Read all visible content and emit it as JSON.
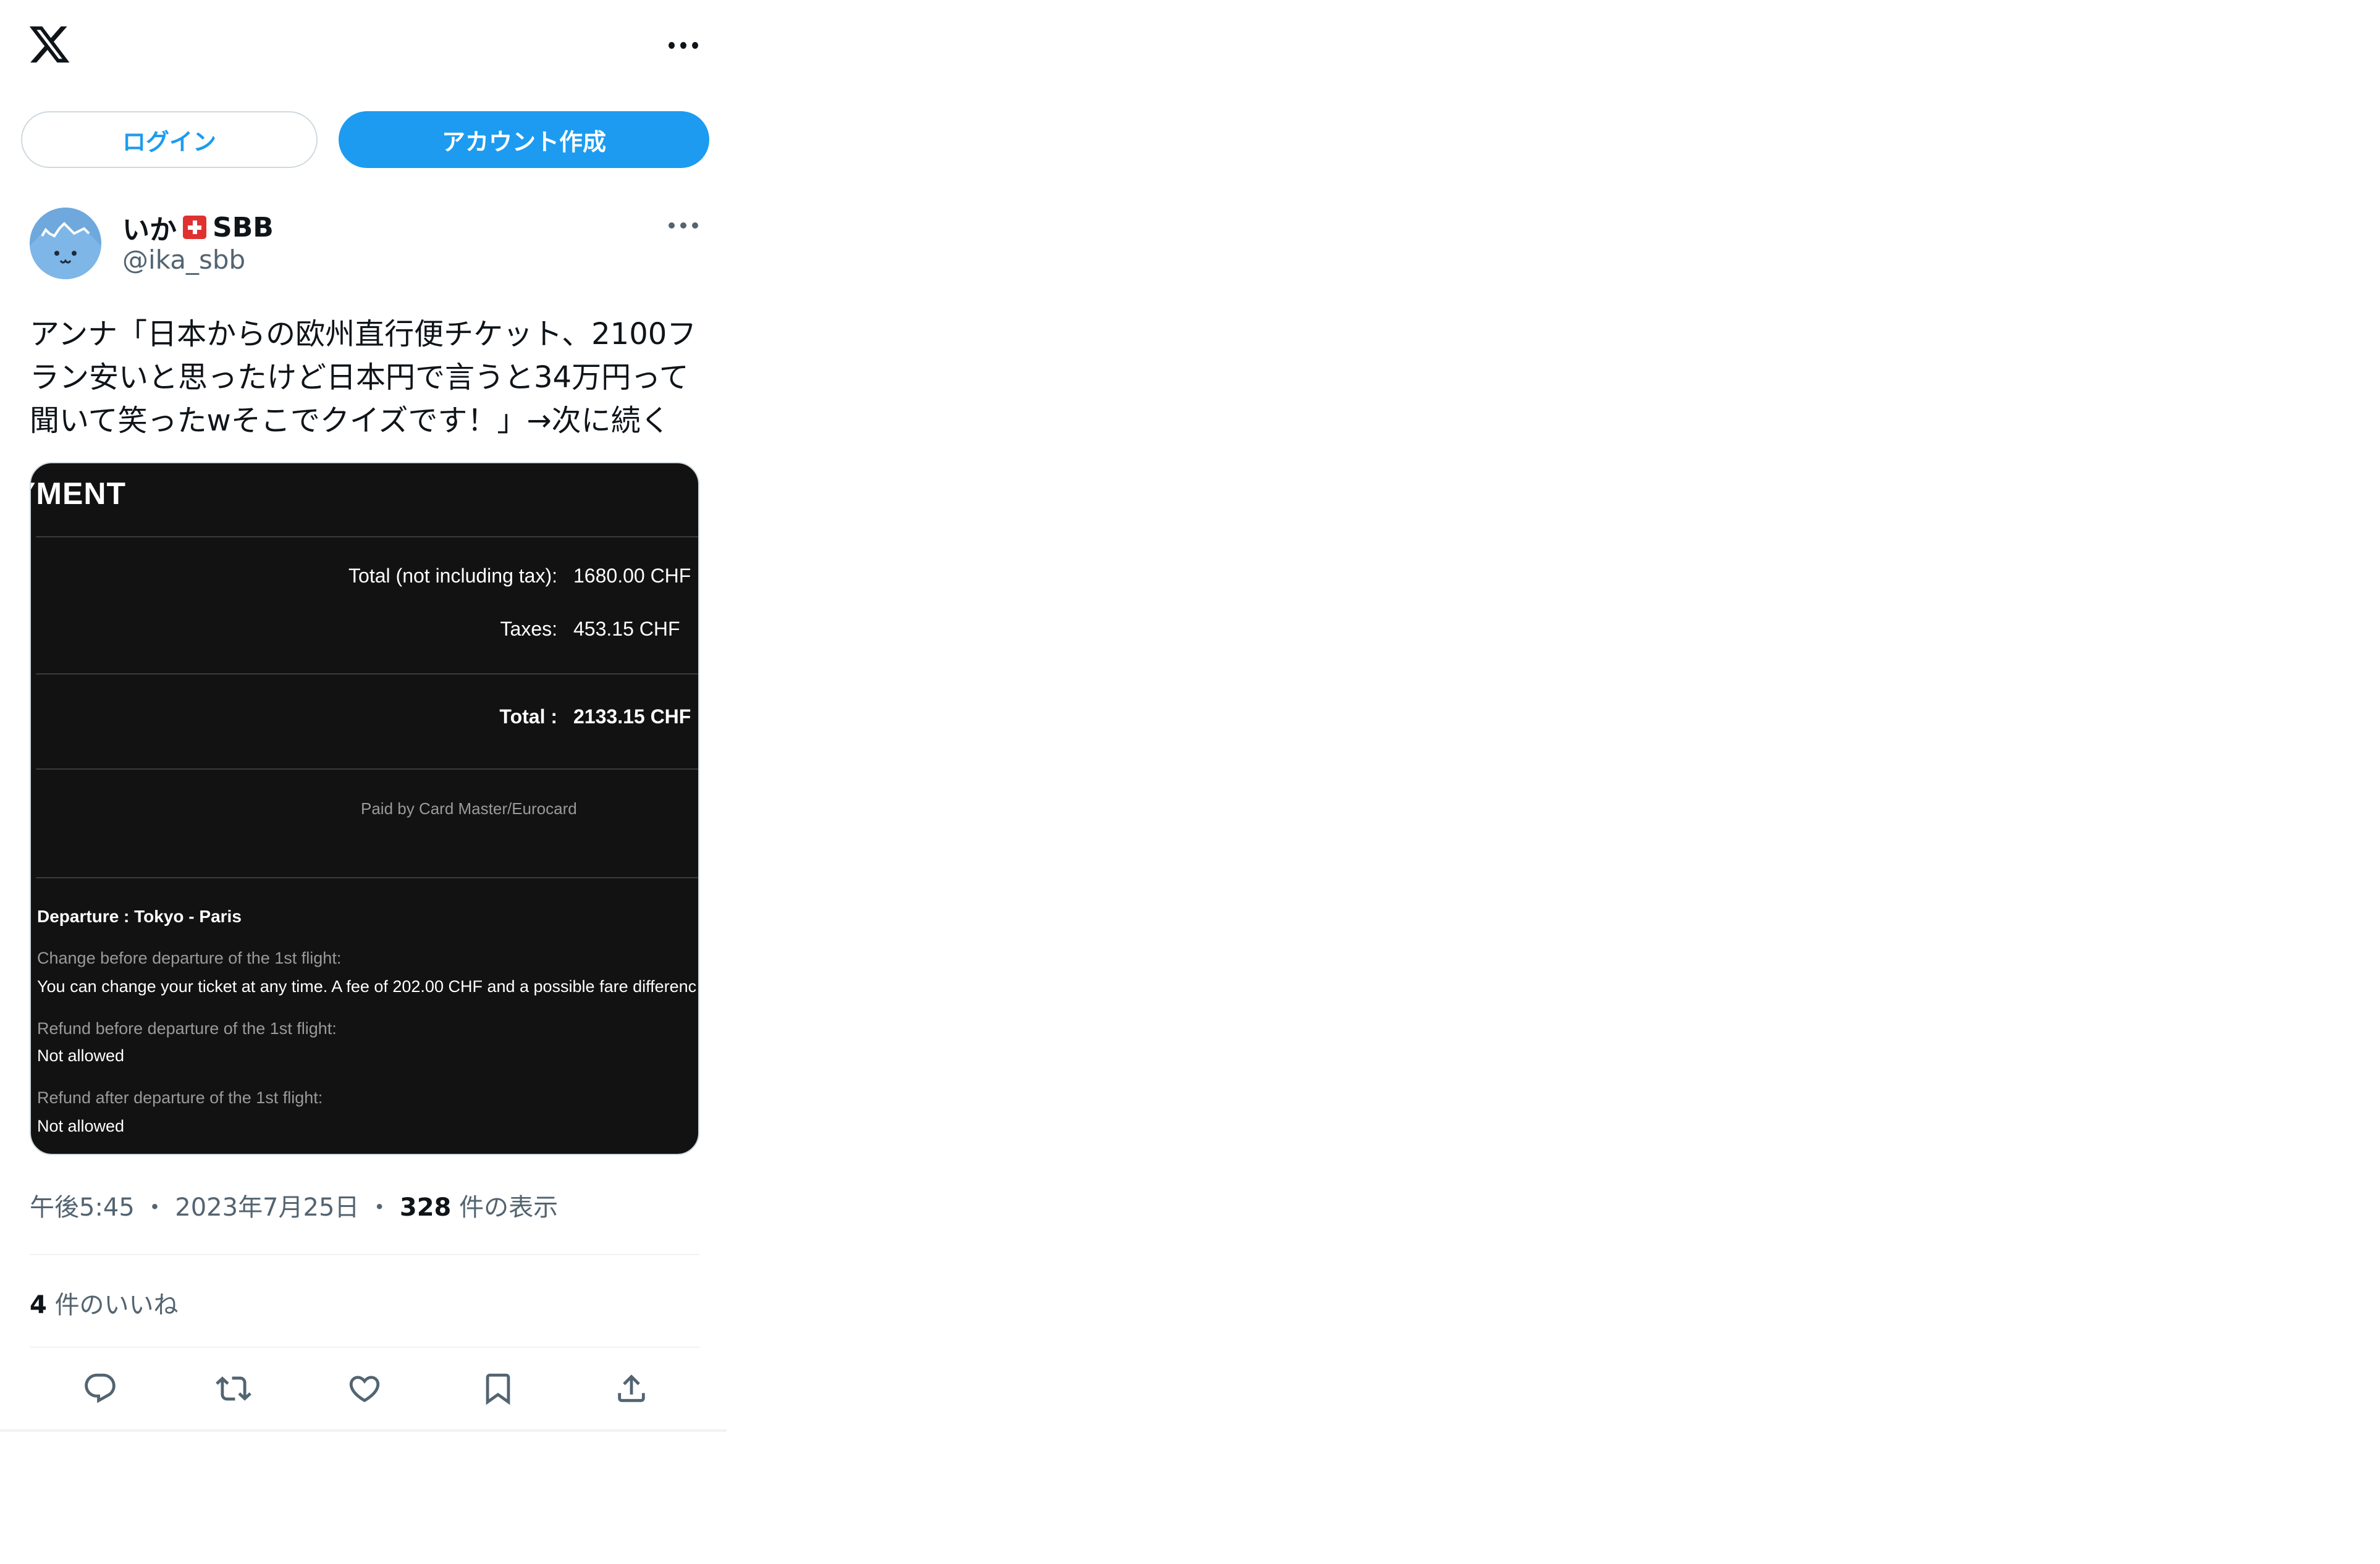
{
  "header": {
    "logo_icon": "x-logo-icon",
    "more_icon": "more-horizontal-icon"
  },
  "auth": {
    "login_label": "ログイン",
    "signup_label": "アカウント作成",
    "accent": "#1d9bf0"
  },
  "tweet": {
    "display_name": "いか",
    "name_suffix": "SBB",
    "handle": "@ika_sbb",
    "text_lines": [
      "アンナ「日本からの欧州直行便チケット、2100フ",
      "ラン安いと思ったけど日本円で言うと34万円って",
      "聞いて笑ったwそこでクイズです！」→次に続く"
    ],
    "time": "午後5:45",
    "date": "2023年7月25日",
    "views_count": "328",
    "views_label": "件の表示",
    "likes_count": "4",
    "likes_label": "件のいいね"
  },
  "media": {
    "heading": "YMENT",
    "rows": [
      {
        "label": "Total (not including tax):",
        "value": "1680.00 CHF"
      },
      {
        "label": "Taxes:",
        "value": "453.15 CHF"
      }
    ],
    "total_label": "Total :",
    "total_value": "2133.15 CHF",
    "paid_by": "Paid by Card Master/Eurocard",
    "departure": "Departure : Tokyo - Paris",
    "change_label": "Change before departure of the 1st flight:",
    "change_text": "You can change your ticket at any time. A fee of 202.00 CHF and a possible fare differenc",
    "refund_before_label": "Refund before departure of the 1st flight:",
    "refund_before_text": "Not allowed",
    "refund_after_label": "Refund after departure of the 1st flight:",
    "refund_after_text": "Not allowed"
  },
  "actions": {
    "icons": [
      "reply-icon",
      "retweet-icon",
      "like-icon",
      "bookmark-icon",
      "share-icon"
    ]
  }
}
